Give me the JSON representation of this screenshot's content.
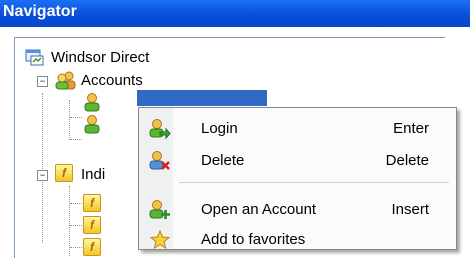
{
  "window": {
    "title": "Navigator"
  },
  "tree": {
    "root": "Windsor Direct",
    "accounts": "Accounts",
    "indices_prefix": "Indi"
  },
  "context_menu": {
    "items": [
      {
        "label": "Login",
        "shortcut": "Enter",
        "icon": "login-user-arrow-icon"
      },
      {
        "label": "Delete",
        "shortcut": "Delete",
        "icon": "delete-user-icon"
      },
      {
        "label": "Open an Account",
        "shortcut": "Insert",
        "icon": "add-user-icon"
      },
      {
        "label": "Add to favorites",
        "shortcut": "",
        "icon": "star-icon"
      }
    ]
  },
  "colors": {
    "titlebar": "#0a4fd8",
    "selection": "#316ac5"
  }
}
